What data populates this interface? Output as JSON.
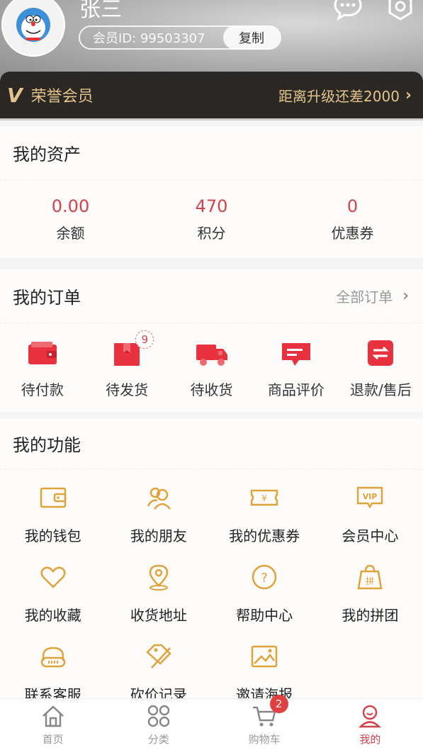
{
  "colors": {
    "accent": "#d4424e",
    "gold": "#e3c48d",
    "func_icon": "#e0a23a"
  },
  "profile": {
    "name": "张三",
    "member_id_label": "会员ID: 99503307",
    "copy_label": "复制",
    "avatar_icon": "cartoon-avatar-icon",
    "message_icon": "message-icon",
    "settings_icon": "settings-icon"
  },
  "vip": {
    "logo": "V",
    "level": "荣誉会员",
    "upgrade_text": "距离升级还差2000"
  },
  "assets": {
    "title": "我的资产",
    "items": [
      {
        "value": "0.00",
        "label": "余额"
      },
      {
        "value": "470",
        "label": "积分"
      },
      {
        "value": "0",
        "label": "优惠券"
      }
    ]
  },
  "orders": {
    "title": "我的订单",
    "all_label": "全部订单",
    "items": [
      {
        "label": "待付款",
        "icon": "wallet-icon"
      },
      {
        "label": "待发货",
        "icon": "package-icon",
        "badge": "9"
      },
      {
        "label": "待收货",
        "icon": "truck-icon"
      },
      {
        "label": "商品评价",
        "icon": "comment-icon"
      },
      {
        "label": "退款/售后",
        "icon": "refund-icon"
      }
    ]
  },
  "functions": {
    "title": "我的功能",
    "items": [
      {
        "label": "我的钱包",
        "icon": "wallet-icon"
      },
      {
        "label": "我的朋友",
        "icon": "friends-icon"
      },
      {
        "label": "我的优惠券",
        "icon": "coupon-icon"
      },
      {
        "label": "会员中心",
        "icon": "vip-icon"
      },
      {
        "label": "我的收藏",
        "icon": "heart-icon"
      },
      {
        "label": "收货地址",
        "icon": "location-icon"
      },
      {
        "label": "帮助中心",
        "icon": "help-icon"
      },
      {
        "label": "我的拼团",
        "icon": "group-buy-icon"
      },
      {
        "label": "联系客服",
        "icon": "headset-icon"
      },
      {
        "label": "砍价记录",
        "icon": "bargain-tag-icon"
      },
      {
        "label": "邀请海报",
        "icon": "poster-icon"
      }
    ]
  },
  "tabbar": {
    "items": [
      {
        "label": "首页",
        "icon": "home-icon"
      },
      {
        "label": "分类",
        "icon": "category-icon"
      },
      {
        "label": "购物车",
        "icon": "cart-icon",
        "badge": "2"
      },
      {
        "label": "我的",
        "icon": "profile-icon",
        "active": true
      }
    ]
  }
}
